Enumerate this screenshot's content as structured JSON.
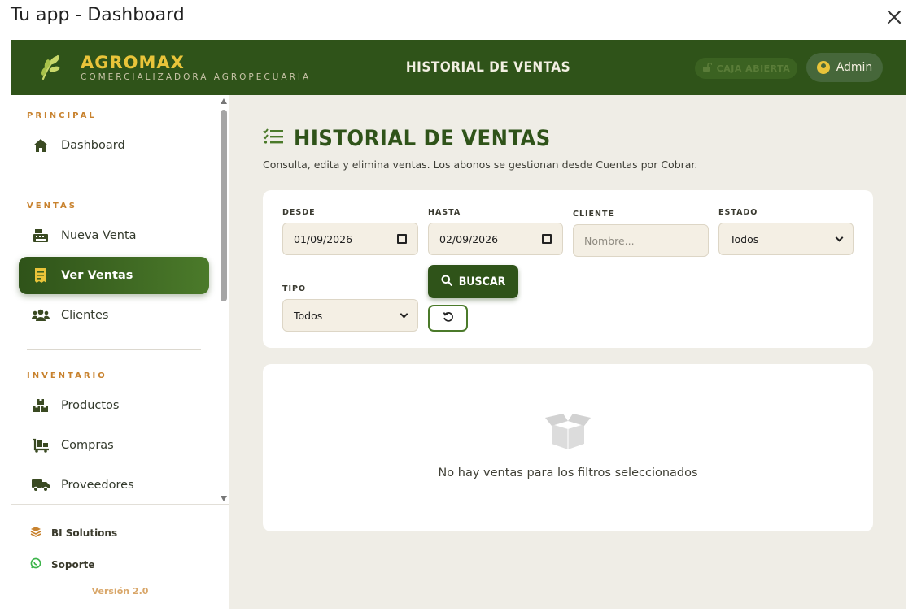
{
  "window": {
    "title": "Tu app - Dashboard"
  },
  "brand": {
    "name": "AGROMAX",
    "subtitle": "COMERCIALIZADORA AGROPECUARIA"
  },
  "topbar": {
    "title": "HISTORIAL DE VENTAS",
    "caja_label": "CAJA ABIERTA",
    "user_label": "Admin"
  },
  "colors": {
    "primary": "#2f5319",
    "accent": "#e9c43a",
    "section_label": "#c8822e",
    "background": "#efede6"
  },
  "sidebar": {
    "sections": [
      {
        "label": "PRINCIPAL",
        "items": [
          {
            "label": "Dashboard",
            "icon": "home-icon"
          }
        ]
      },
      {
        "label": "VENTAS",
        "items": [
          {
            "label": "Nueva Venta",
            "icon": "cash-register-icon"
          },
          {
            "label": "Ver Ventas",
            "icon": "receipt-icon",
            "active": true
          },
          {
            "label": "Clientes",
            "icon": "users-icon"
          }
        ]
      },
      {
        "label": "INVENTARIO",
        "items": [
          {
            "label": "Productos",
            "icon": "boxes-icon"
          },
          {
            "label": "Compras",
            "icon": "dolly-icon"
          },
          {
            "label": "Proveedores",
            "icon": "truck-icon"
          }
        ]
      }
    ],
    "footer": {
      "bi_label": "BI Solutions",
      "support_label": "Soporte",
      "version": "Versión 2.0"
    }
  },
  "page": {
    "title": "HISTORIAL DE VENTAS",
    "subtitle": "Consulta, edita y elimina ventas. Los abonos se gestionan desde Cuentas por Cobrar."
  },
  "filters": {
    "desde": {
      "label": "DESDE",
      "value": "01/09/2026"
    },
    "hasta": {
      "label": "HASTA",
      "value": "02/09/2026"
    },
    "cliente": {
      "label": "CLIENTE",
      "placeholder": "Nombre..."
    },
    "estado": {
      "label": "ESTADO",
      "value": "Todos"
    },
    "tipo": {
      "label": "TIPO",
      "value": "Todos"
    },
    "search_button": "BUSCAR"
  },
  "results": {
    "empty_message": "No hay ventas para los filtros seleccionados"
  }
}
